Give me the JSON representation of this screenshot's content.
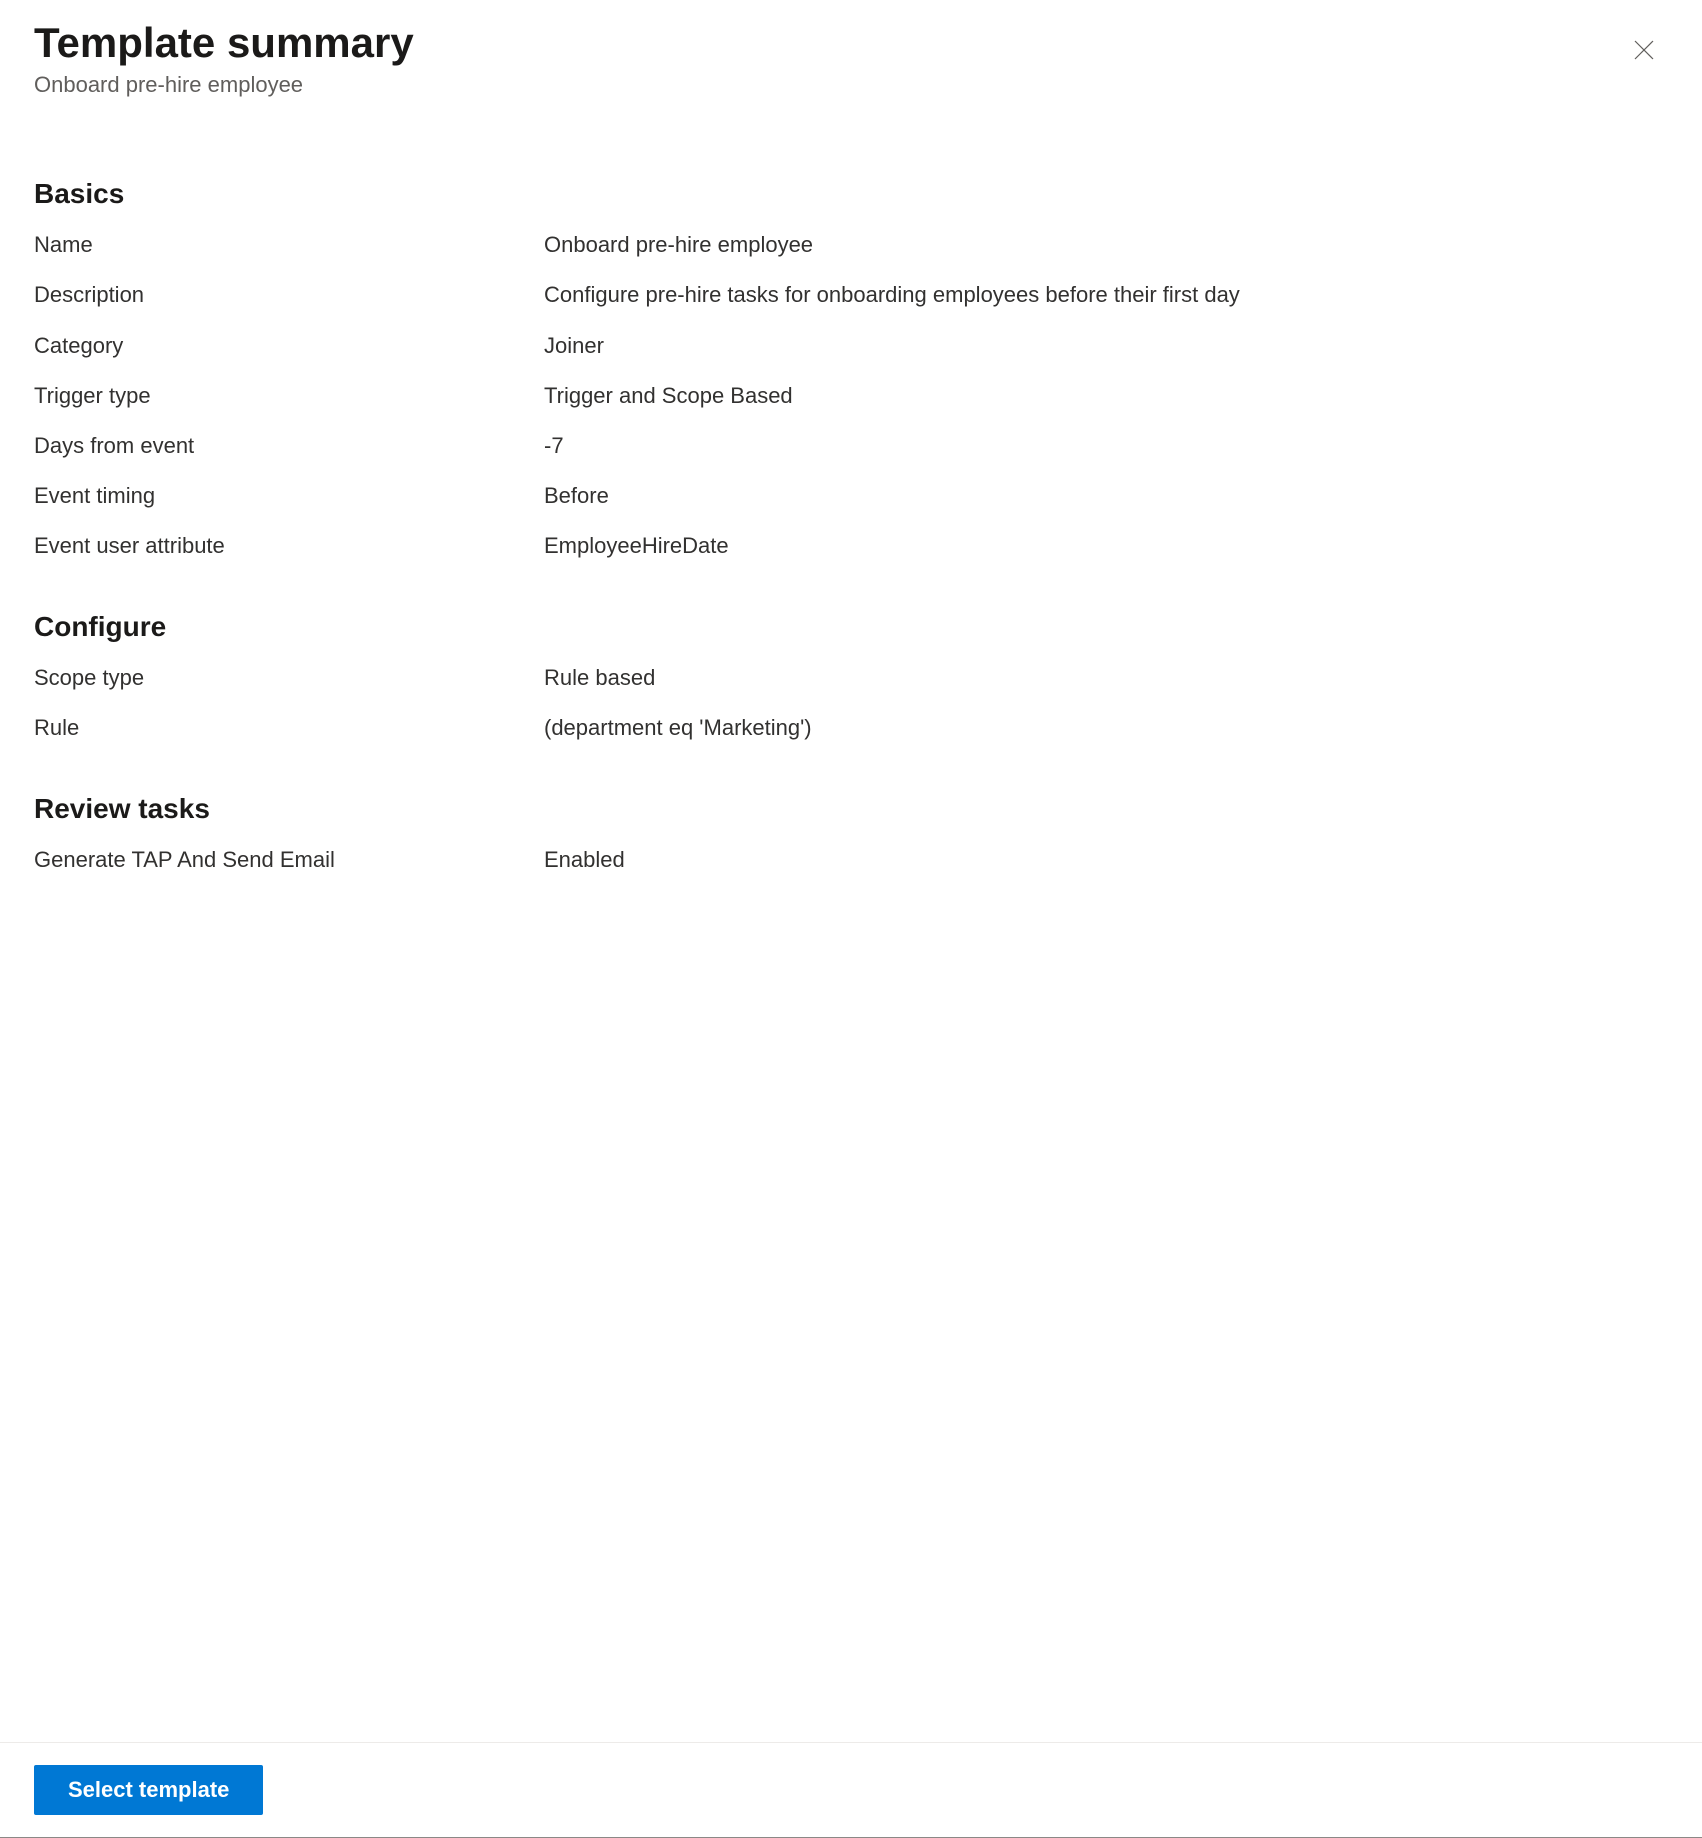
{
  "header": {
    "title": "Template summary",
    "subtitle": "Onboard pre-hire employee"
  },
  "sections": {
    "basics": {
      "heading": "Basics",
      "rows": {
        "name": {
          "label": "Name",
          "value": "Onboard pre-hire employee"
        },
        "description": {
          "label": "Description",
          "value": "Configure pre-hire tasks for onboarding employees before their first day"
        },
        "category": {
          "label": "Category",
          "value": "Joiner"
        },
        "trigger_type": {
          "label": "Trigger type",
          "value": "Trigger and Scope Based"
        },
        "days_from_event": {
          "label": "Days from event",
          "value": "-7"
        },
        "event_timing": {
          "label": "Event timing",
          "value": "Before"
        },
        "event_user_attribute": {
          "label": "Event user attribute",
          "value": "EmployeeHireDate"
        }
      }
    },
    "configure": {
      "heading": "Configure",
      "rows": {
        "scope_type": {
          "label": "Scope type",
          "value": "Rule based"
        },
        "rule": {
          "label": "Rule",
          "value": "(department eq 'Marketing')"
        }
      }
    },
    "review_tasks": {
      "heading": "Review tasks",
      "rows": {
        "tap_email": {
          "label": "Generate TAP And Send Email",
          "value": "Enabled"
        }
      }
    }
  },
  "footer": {
    "select_template_label": "Select template"
  }
}
